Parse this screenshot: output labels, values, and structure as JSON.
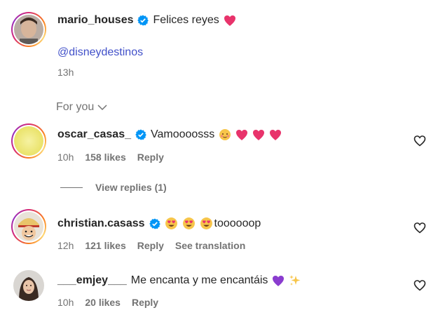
{
  "post": {
    "username": "mario_houses",
    "caption": "Felices reyes",
    "mention": "@disneydestinos",
    "time": "13h"
  },
  "section": {
    "for_you_label": "For you"
  },
  "comments": [
    {
      "username": "oscar_casas_",
      "text": "Vamoooosss",
      "time": "10h",
      "likes": "158 likes",
      "reply": "Reply",
      "view_replies": "View replies (1)"
    },
    {
      "username": "christian.casass",
      "text": "toooooop",
      "time": "12h",
      "likes": "121 likes",
      "reply": "Reply",
      "see_translation": "See translation"
    },
    {
      "username": "___emjey___",
      "text": "Me encanta y me encantáis",
      "time": "10h",
      "likes": "20 likes",
      "reply": "Reply"
    }
  ],
  "icons": {
    "verified": "verified-badge-icon",
    "heart": "heart-outline-icon",
    "chevron": "chevron-down-icon"
  },
  "colors": {
    "verified": "#0095f6",
    "link": "#4150c9",
    "heart_emoji": "#e8336b",
    "purple_heart": "#8a3ccf"
  }
}
